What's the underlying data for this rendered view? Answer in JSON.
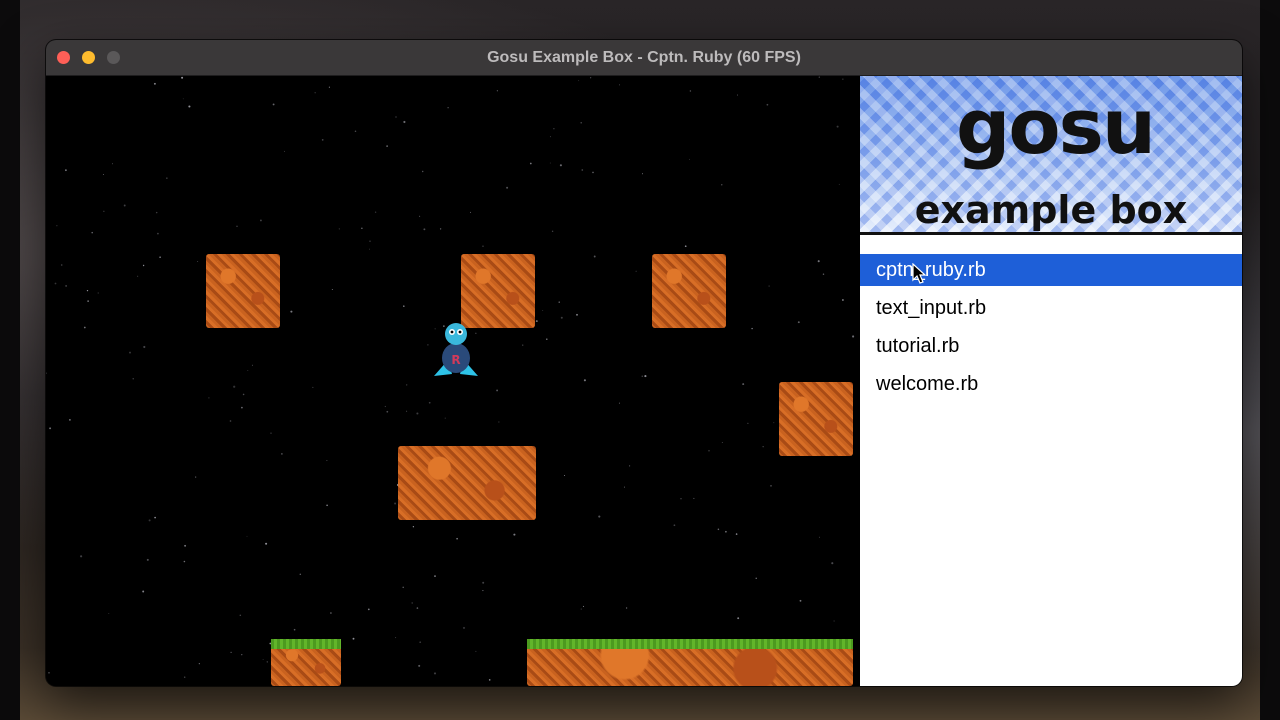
{
  "window": {
    "title": "Gosu Example Box - Cptn. Ruby (60 FPS)"
  },
  "sidebar": {
    "logo_word": "gosu",
    "logo_subtitle": "example box",
    "files": [
      {
        "label": "cptn_ruby.rb",
        "selected": true
      },
      {
        "label": "text_input.rb",
        "selected": false
      },
      {
        "label": "tutorial.rb",
        "selected": false
      },
      {
        "label": "welcome.rb",
        "selected": false
      }
    ]
  },
  "colors": {
    "selection": "#1e5fd8",
    "close": "#fe5f57",
    "minimize": "#febc2e",
    "dirt": "#c9621f",
    "grass": "#4c9a1f"
  },
  "game": {
    "player_sprite": "cptn-ruby-icon"
  }
}
